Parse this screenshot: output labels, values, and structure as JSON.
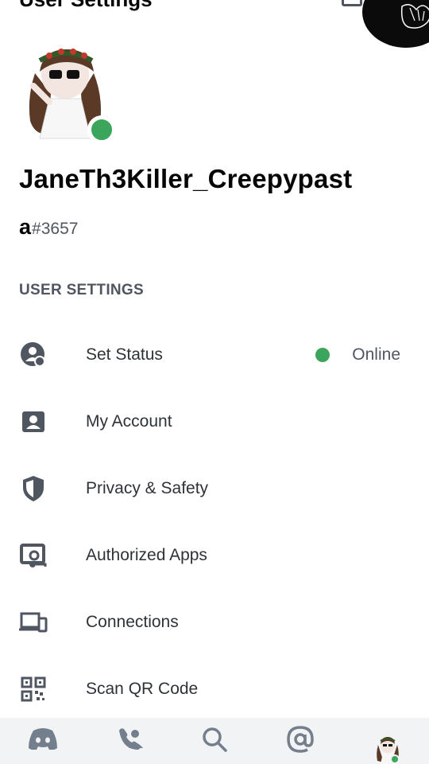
{
  "header": {
    "title": "User Settings"
  },
  "profile": {
    "username": "JaneTh3Killer_Creepypast",
    "tag_prefix": "a",
    "discriminator": "#3657",
    "status_color": "#3ba55c"
  },
  "section": {
    "title": "USER SETTINGS"
  },
  "menu": [
    {
      "label": "Set Status",
      "icon": "status-icon",
      "value": "Online"
    },
    {
      "label": "My Account",
      "icon": "account-icon"
    },
    {
      "label": "Privacy & Safety",
      "icon": "shield-icon"
    },
    {
      "label": "Authorized Apps",
      "icon": "authorized-apps-icon"
    },
    {
      "label": "Connections",
      "icon": "devices-icon"
    },
    {
      "label": "Scan QR Code",
      "icon": "qr-code-icon"
    }
  ],
  "bottom_nav": [
    {
      "icon": "discord-home-icon"
    },
    {
      "icon": "friends-icon"
    },
    {
      "icon": "search-icon"
    },
    {
      "icon": "mentions-icon"
    },
    {
      "icon": "profile-avatar-icon"
    }
  ],
  "colors": {
    "online": "#3ba55c",
    "icon": "#4f5660",
    "nav_background": "#f2f3f5"
  }
}
